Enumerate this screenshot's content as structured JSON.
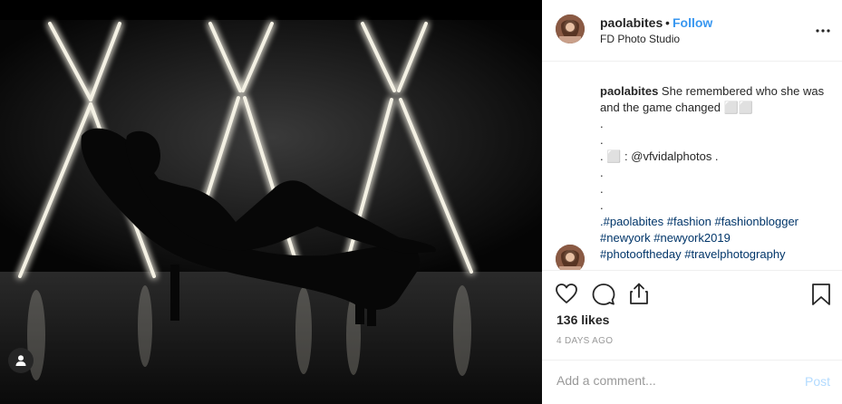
{
  "header": {
    "username": "paolabites",
    "separator": "•",
    "follow_label": "Follow",
    "location": "FD Photo Studio",
    "more_icon": "more-horizontal-icon"
  },
  "caption": {
    "username": "paolabites",
    "text_1": "She remembered who she was and the game changed ⬜⬜",
    "dot_a": ".",
    "dot_b": ".",
    "credit": ". ⬜ : @vfvidalphotos .",
    "dot_c": ".",
    "dot_d": ".",
    "dot_e": ".",
    "hashtags_1": ".#paolabites #fashion #fashionblogger",
    "hashtags_2": "#newyork #newyork2019",
    "hashtags_3": "#photooftheday #travelphotography"
  },
  "actions": {
    "icons": [
      "heart-icon",
      "comment-icon",
      "share-icon",
      "bookmark-icon"
    ],
    "likes": "136 likes",
    "date": "4 DAYS AGO"
  },
  "comment_box": {
    "placeholder": "Add a comment...",
    "post_label": "Post"
  },
  "colors": {
    "accent": "#3897f0",
    "text": "#262626",
    "muted": "#999999",
    "post_disabled": "#b3dbff",
    "hashtag": "#003569"
  }
}
